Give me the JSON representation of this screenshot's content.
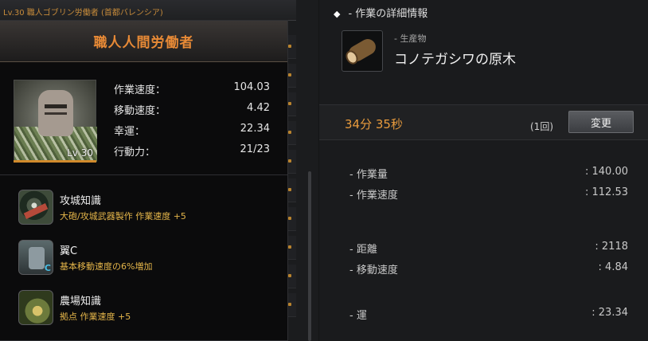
{
  "background": {
    "header_text": "Lv.30 職人ゴブリン労働者 (首都バレンシア)"
  },
  "worker_card": {
    "title": "職人人間労働者",
    "level_badge": "Lv 30",
    "stats": [
      {
        "label": "作業速度：",
        "value": "104.03"
      },
      {
        "label": "移動速度：",
        "value": "4.42"
      },
      {
        "label": "幸運：",
        "value": "22.34"
      },
      {
        "label": "行動力：",
        "value": "21/23"
      }
    ],
    "skills": [
      {
        "name": "攻城知識",
        "desc": "大砲/攻城武器製作 作業速度 +5",
        "icon": "siege-knowledge-icon"
      },
      {
        "name": "翼C",
        "desc": "基本移動速度の6%増加",
        "icon": "wing-c-icon"
      },
      {
        "name": "農場知識",
        "desc": "拠点 作業速度 +5",
        "icon": "farm-knowledge-icon"
      }
    ]
  },
  "detail_panel": {
    "header": "- 作業の詳細情報",
    "header_glyph": "◆",
    "product_category": "- 生産物",
    "product_name": "コノテガシワの原木",
    "time": "34分 35秒",
    "count": "(1回)",
    "change_button": "変更",
    "rows": [
      {
        "label": "- 作業量",
        "value": ": 140.00"
      },
      {
        "label": "- 作業速度",
        "value": ": 112.53"
      },
      {
        "label": "- 距離",
        "value": ": 2118"
      },
      {
        "label": "- 移動速度",
        "value": ": 4.84"
      },
      {
        "label": "- 運",
        "value": ": 23.34"
      }
    ]
  },
  "colors": {
    "accent_orange": "#e88a36",
    "skill_desc_yellow": "#e5b64a",
    "time_orange": "#e89b3d"
  }
}
